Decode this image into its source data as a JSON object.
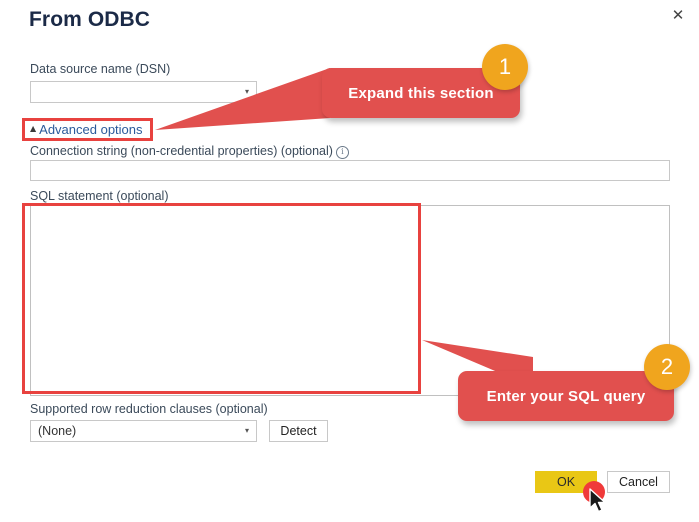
{
  "dialog": {
    "title": "From ODBC",
    "close_label": "✕",
    "close_icon": "close-icon"
  },
  "fields": {
    "dsn": {
      "label": "Data source name (DSN)",
      "value": "",
      "placeholder": "",
      "arrow_glyph": "▾"
    },
    "advanced_options": {
      "label": "Advanced options",
      "triangle_glyph": "◢",
      "expanded": true
    },
    "connection_string": {
      "label": "Connection string (non-credential properties) (optional)",
      "value": "",
      "placeholder": "",
      "info_glyph": "i",
      "info_icon": "info-icon"
    },
    "sql_statement": {
      "label": "SQL statement (optional)",
      "value": "",
      "placeholder": ""
    },
    "row_reduction": {
      "label": "Supported row reduction clauses (optional)",
      "value": "(None)",
      "arrow_glyph": "▾",
      "options": [
        "(None)"
      ]
    },
    "detect": {
      "label": "Detect"
    }
  },
  "footer": {
    "ok_label": "OK",
    "cancel_label": "Cancel"
  },
  "annotations": {
    "callout_1": {
      "text": "Expand this section",
      "badge": "1"
    },
    "callout_2": {
      "text": "Enter your SQL query",
      "badge": "2"
    }
  },
  "colors": {
    "callout_red": "#e1504e",
    "badge_orange": "#f0a51e",
    "highlight_red": "#e8423f",
    "ok_yellow": "#e9c715",
    "click_dot_red": "#f03a3a",
    "title_navy": "#1b2a47"
  }
}
